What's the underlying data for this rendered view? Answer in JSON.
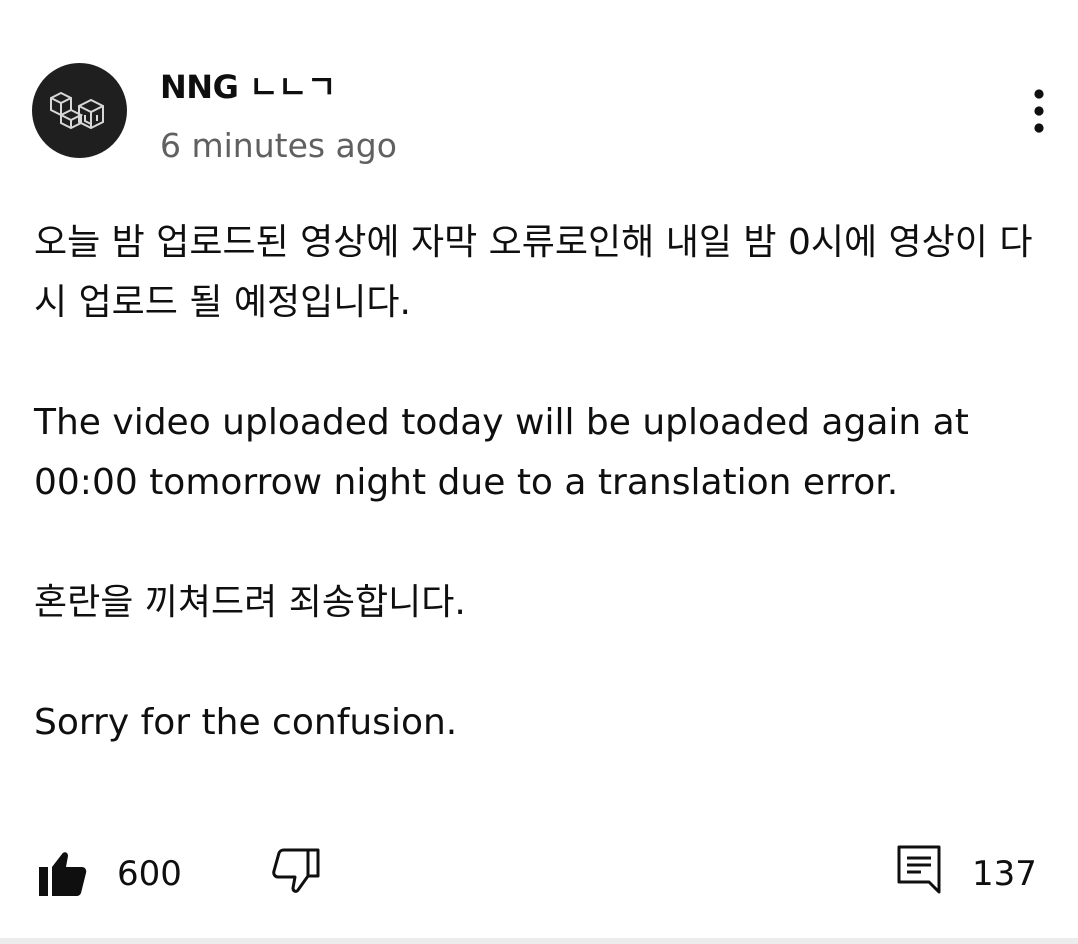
{
  "comment": {
    "author": "NNG ㄴㄴㄱ",
    "timestamp": "6 minutes ago",
    "paragraphs": [
      "오늘 밤 업로드된 영상에 자막 오류로인해 내일 밤 0시에 영상이 다시 업로드 될 예정입니다.",
      "The video uploaded today will be uploaded again at 00:00 tomorrow night due to a translation error.",
      "혼란을 끼쳐드려 죄송합니다.",
      "Sorry for the confusion."
    ]
  },
  "actions": {
    "like_count": "600",
    "reply_count": "137"
  },
  "icons": {
    "menu": "more-vert-icon",
    "like": "thumb-up-icon",
    "dislike": "thumb-down-icon",
    "reply": "comment-icon",
    "avatar": "cube-logo-icon"
  },
  "colors": {
    "text_primary": "#0f0f0f",
    "text_secondary": "#606060",
    "avatar_bg": "#1f1f1f"
  }
}
